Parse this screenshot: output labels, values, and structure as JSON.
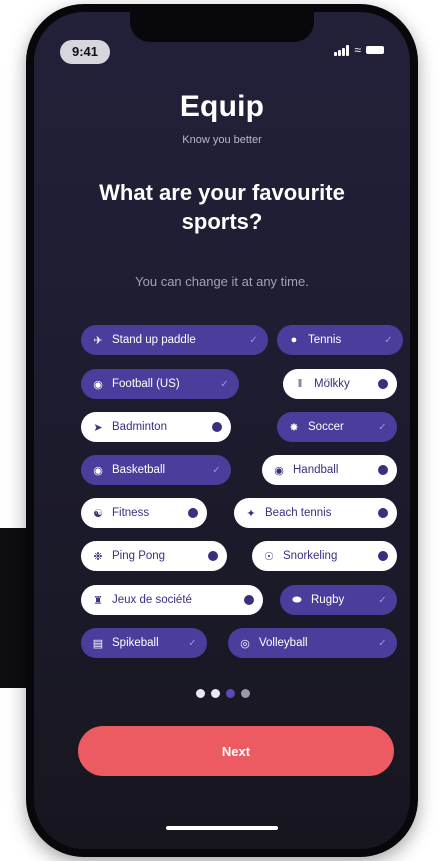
{
  "status": {
    "time": "9:41"
  },
  "header": {
    "app_title": "Equip",
    "subtitle": "Know you better"
  },
  "question": "What are your favourite sports?",
  "hint": "You can change it at any time.",
  "sports": [
    {
      "label": "Stand up paddle",
      "selected": true,
      "icon": "paddle-icon"
    },
    {
      "label": "Tennis",
      "selected": true,
      "icon": "tennis-ball-icon"
    },
    {
      "label": "Football (US)",
      "selected": true,
      "icon": "american-football-icon"
    },
    {
      "label": "Mölkky",
      "selected": false,
      "icon": "molkky-pins-icon"
    },
    {
      "label": "Badminton",
      "selected": false,
      "icon": "shuttlecock-icon"
    },
    {
      "label": "Soccer",
      "selected": true,
      "icon": "soccer-ball-icon"
    },
    {
      "label": "Basketball",
      "selected": true,
      "icon": "basketball-icon"
    },
    {
      "label": "Handball",
      "selected": false,
      "icon": "handball-icon"
    },
    {
      "label": "Fitness",
      "selected": false,
      "icon": "fitness-icon"
    },
    {
      "label": "Beach tennis",
      "selected": false,
      "icon": "beach-tennis-icon"
    },
    {
      "label": "Ping Pong",
      "selected": false,
      "icon": "ping-pong-icon"
    },
    {
      "label": "Snorkeling",
      "selected": false,
      "icon": "snorkel-mask-icon"
    },
    {
      "label": "Jeux de société",
      "selected": false,
      "icon": "board-game-icon"
    },
    {
      "label": "Rugby",
      "selected": true,
      "icon": "rugby-ball-icon"
    },
    {
      "label": "Spikeball",
      "selected": true,
      "icon": "spikeball-icon"
    },
    {
      "label": "Volleyball",
      "selected": true,
      "icon": "volleyball-icon"
    }
  ],
  "pagination": {
    "total": 4,
    "current": 3
  },
  "next_button": {
    "label": "Next"
  },
  "colors": {
    "selected_chip": "#4b3d9c",
    "unselected_chip": "#ffffff",
    "accent_button": "#ec5a62",
    "background": "#1d1c2f"
  }
}
